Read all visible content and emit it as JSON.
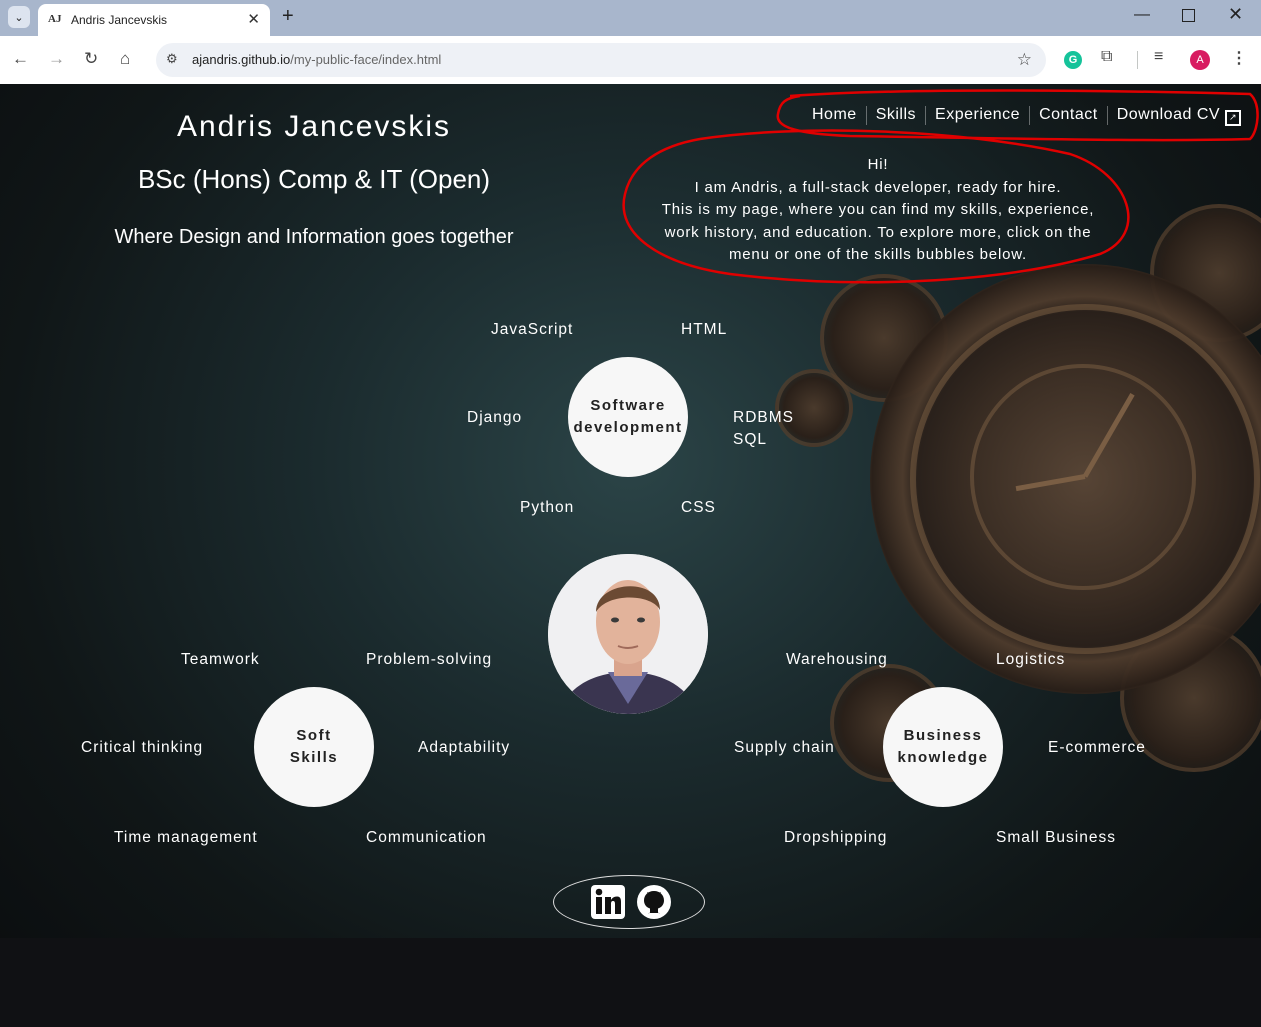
{
  "browser": {
    "tab_title": "Andris Jancevskis",
    "tab_favicon": "AJ",
    "url_domain": "ajandris.github.io",
    "url_path": "/my-public-face/index.html",
    "icons": [
      "back-icon",
      "forward-icon",
      "reload-icon",
      "home-icon",
      "site-info-icon",
      "star-icon",
      "grammarly-icon",
      "extensions-icon",
      "media-icon",
      "profile-avatar",
      "more-icon"
    ],
    "avatar_letter": "A"
  },
  "header": {
    "name": "Andris Jancevskis",
    "degree": "BSc (Hons) Comp & IT (Open)",
    "tagline": "Where Design and Information goes together"
  },
  "nav": {
    "items": [
      "Home",
      "Skills",
      "Experience",
      "Contact",
      "Download CV"
    ]
  },
  "intro": {
    "line1": "Hi!",
    "line2": "I am Andris, a full-stack developer, ready for hire.",
    "line3": "This is my page, where you can find my skills, experience,",
    "line4": "work history, and education. To explore more, click on the",
    "line5": "menu or one of the skills bubbles below."
  },
  "software": {
    "bubble_line1": "Software",
    "bubble_line2": "development",
    "skills": [
      "JavaScript",
      "HTML",
      "Django",
      "RDBMS",
      "SQL",
      "Python",
      "CSS"
    ]
  },
  "soft": {
    "bubble_line1": "Soft",
    "bubble_line2": "Skills",
    "skills": [
      "Teamwork",
      "Problem-solving",
      "Critical thinking",
      "Adaptability",
      "Time management",
      "Communication"
    ]
  },
  "business": {
    "bubble_line1": "Business",
    "bubble_line2": "knowledge",
    "skills": [
      "Warehousing",
      "Logistics",
      "Supply chain",
      "E-commerce",
      "Dropshipping",
      "Small Business"
    ]
  },
  "social": {
    "icons": [
      "linkedin-icon",
      "github-icon"
    ]
  },
  "colors": {
    "annotation_red": "#e00000",
    "page_bg": "#1b2b2e",
    "bubble_bg": "#f7f7f7"
  }
}
